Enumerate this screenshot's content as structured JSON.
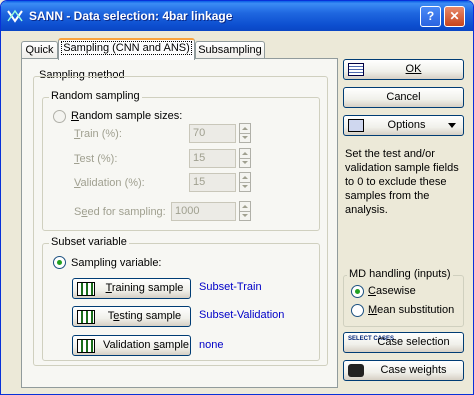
{
  "window": {
    "title": "SANN - Data selection: 4bar linkage",
    "help_glyph": "?",
    "close_glyph": "✕"
  },
  "tabs": [
    {
      "label": "Quick",
      "active": false
    },
    {
      "label": "Sampling (CNN and ANS)",
      "active": true
    },
    {
      "label": "Subsampling",
      "active": false
    }
  ],
  "sampling_method": {
    "legend": "Sampling method",
    "random_sampling": {
      "legend": "Random sampling",
      "option_label_u": "R",
      "option_label_rest": "andom sample sizes:",
      "selected": false,
      "train": {
        "label_u": "T",
        "label_rest": "rain (%):",
        "value": "70"
      },
      "test": {
        "label_u": "T",
        "label_rest": "est (%):",
        "value": "15"
      },
      "validation": {
        "label_u": "V",
        "label_rest": "alidation (%):",
        "value": "15"
      },
      "seed": {
        "label_pre": "S",
        "label_u": "e",
        "label_rest": "ed for sampling:",
        "value": "1000"
      }
    },
    "subset_variable": {
      "legend": "Subset variable",
      "option_label": "Sampling variable:",
      "selected": true,
      "training": {
        "button_u": "T",
        "button_rest": "raining sample",
        "value": "Subset-Train"
      },
      "testing": {
        "button_pre": "T",
        "button_u": "e",
        "button_rest": "sting sample",
        "value": "Subset-Validation"
      },
      "validation": {
        "button_pre": "Validation ",
        "button_u": "s",
        "button_rest": "ample",
        "value": "none"
      }
    }
  },
  "right_panel": {
    "ok": {
      "label": "OK",
      "icon": "grid-icon"
    },
    "cancel": {
      "label": "Cancel"
    },
    "options": {
      "label": "Options",
      "icon": "options-icon"
    },
    "note": "Set the test and/or validation sample fields to 0 to exclude these samples from the analysis.",
    "md_handling": {
      "legend": "MD handling (inputs)",
      "casewise": {
        "label_u": "C",
        "label_rest": "asewise",
        "selected": true
      },
      "mean_substitution": {
        "label_u": "M",
        "label_rest": "ean substitution",
        "selected": false
      }
    },
    "case_selection": {
      "label": "Case selection",
      "icon_text": "SELECT CASES"
    },
    "case_weights": {
      "label": "Case weights",
      "icon": "weights-icon"
    }
  },
  "colors": {
    "title_bar": "#0a54d8",
    "value_text": "#0000c8",
    "window_bg": "#ece9d8"
  }
}
